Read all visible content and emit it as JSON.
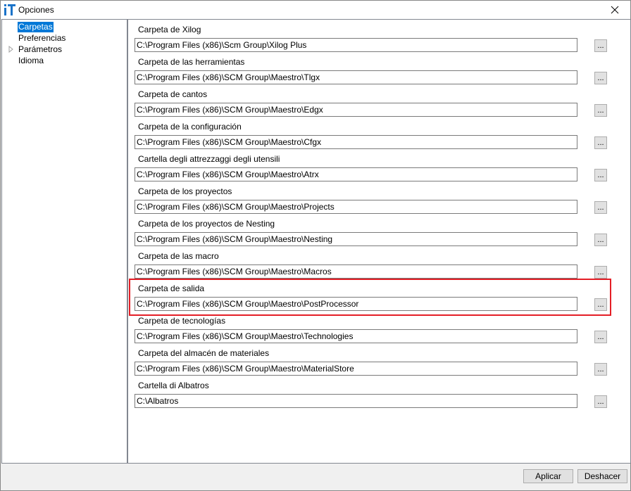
{
  "window": {
    "title": "Opciones",
    "app_icon": "it-logo-icon",
    "close_icon": "close-icon"
  },
  "tree": {
    "items": [
      {
        "label": "Carpetas",
        "selected": true,
        "expandable": false
      },
      {
        "label": "Preferencias",
        "selected": false,
        "expandable": false
      },
      {
        "label": "Parámetros",
        "selected": false,
        "expandable": true
      },
      {
        "label": "Idioma",
        "selected": false,
        "expandable": false
      }
    ]
  },
  "folders": [
    {
      "label": "Carpeta de Xilog",
      "value": "C:\\Program Files (x86)\\Scm Group\\Xilog Plus",
      "button": "..."
    },
    {
      "label": "Carpeta de las herramientas",
      "value": "C:\\Program Files (x86)\\SCM Group\\Maestro\\Tlgx",
      "button": "..."
    },
    {
      "label": "Carpeta de cantos",
      "value": "C:\\Program Files (x86)\\SCM Group\\Maestro\\Edgx",
      "button": "..."
    },
    {
      "label": "Carpeta de la configuración",
      "value": "C:\\Program Files (x86)\\SCM Group\\Maestro\\Cfgx",
      "button": "..."
    },
    {
      "label": "Cartella degli attrezzaggi degli utensili",
      "value": "C:\\Program Files (x86)\\SCM Group\\Maestro\\Atrx",
      "button": "..."
    },
    {
      "label": "Carpeta de los proyectos",
      "value": "C:\\Program Files (x86)\\SCM Group\\Maestro\\Projects",
      "button": "..."
    },
    {
      "label": "Carpeta de los proyectos de Nesting",
      "value": "C:\\Program Files (x86)\\SCM Group\\Maestro\\Nesting",
      "button": "..."
    },
    {
      "label": "Carpeta de las macro",
      "value": "C:\\Program Files (x86)\\SCM Group\\Maestro\\Macros",
      "button": "..."
    },
    {
      "label": "Carpeta de salida",
      "value": "C:\\Program Files (x86)\\SCM Group\\Maestro\\PostProcessor",
      "button": "...",
      "highlighted": true
    },
    {
      "label": "Carpeta de tecnologías",
      "value": "C:\\Program Files (x86)\\SCM Group\\Maestro\\Technologies",
      "button": "..."
    },
    {
      "label": "Carpeta del almacén de materiales",
      "value": "C:\\Program Files (x86)\\SCM Group\\Maestro\\MaterialStore",
      "button": "..."
    },
    {
      "label": "Cartella di Albatros",
      "value": "C:\\Albatros",
      "button": "..."
    }
  ],
  "footer": {
    "apply_label": "Aplicar",
    "undo_label": "Deshacer"
  },
  "colors": {
    "selection": "#0078d7",
    "highlight_border": "#e41e26",
    "app_icon_blue": "#1a73c9"
  }
}
